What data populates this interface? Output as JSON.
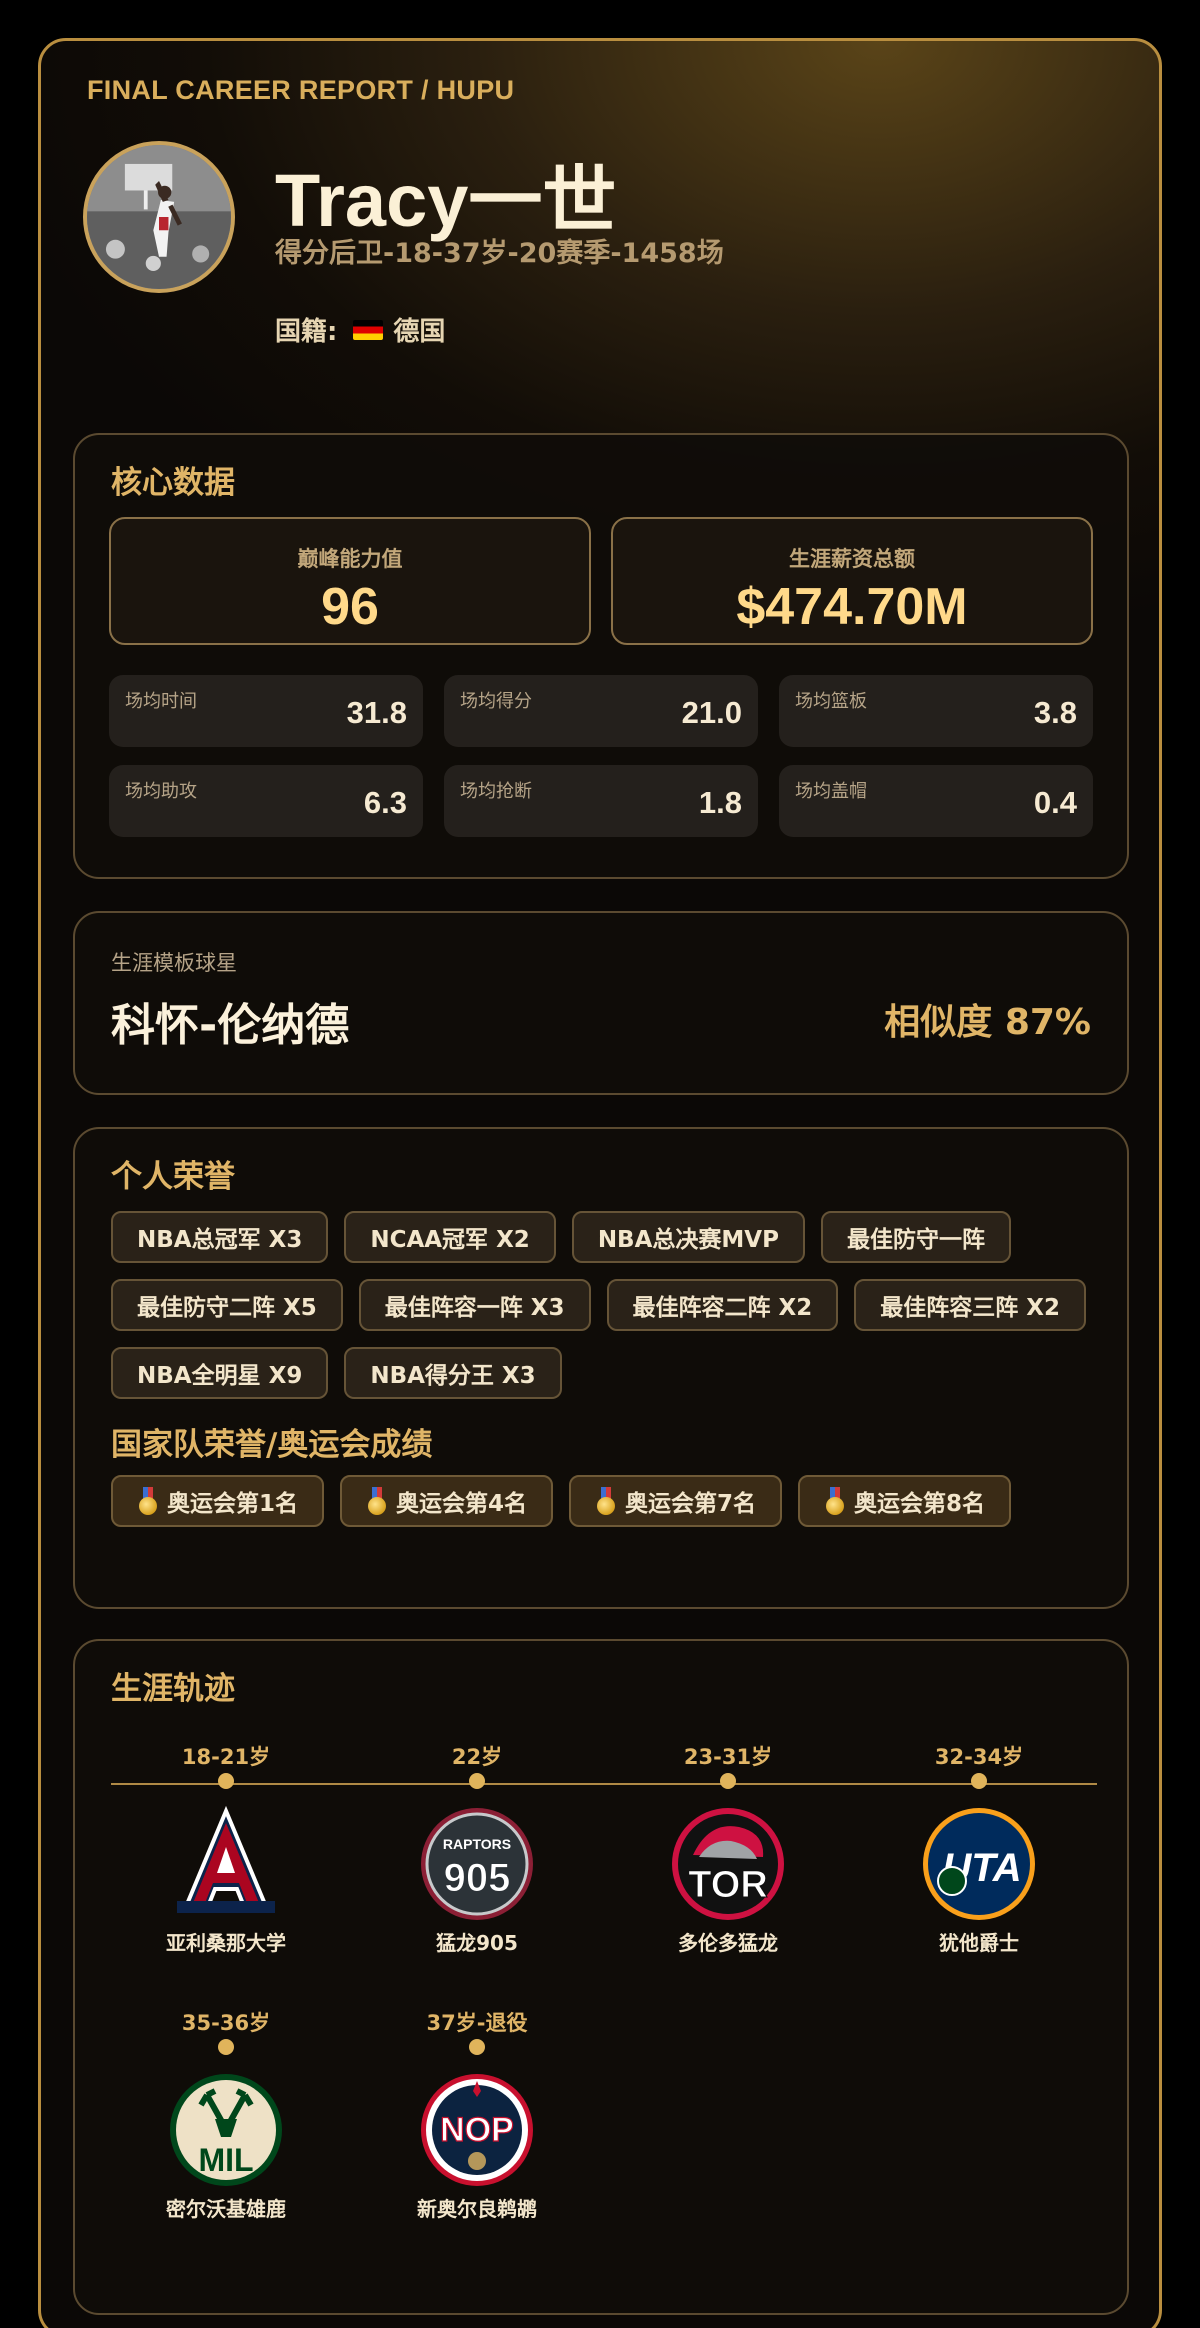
{
  "report_tag": "FINAL CAREER REPORT / HUPU",
  "player": {
    "name": "Tracy一世",
    "subtitle": "得分后卫-18-37岁-20赛季-1458场",
    "nationality_label": "国籍:",
    "nationality": "德国",
    "flag_icon": "germany-flag"
  },
  "core": {
    "title": "核心数据",
    "peak_label": "巅峰能力值",
    "peak_value": "96",
    "salary_label": "生涯薪资总额",
    "salary_value": "$474.70M",
    "stats": [
      {
        "label": "场均时间",
        "value": "31.8"
      },
      {
        "label": "场均得分",
        "value": "21.0"
      },
      {
        "label": "场均篮板",
        "value": "3.8"
      },
      {
        "label": "场均助攻",
        "value": "6.3"
      },
      {
        "label": "场均抢断",
        "value": "1.8"
      },
      {
        "label": "场均盖帽",
        "value": "0.4"
      }
    ]
  },
  "template": {
    "label": "生涯模板球星",
    "name": "科怀-伦纳德",
    "similarity": "相似度 87%"
  },
  "honors": {
    "title": "个人荣誉",
    "items": [
      "NBA总冠军 X3",
      "NCAA冠军 X2",
      "NBA总决赛MVP",
      "最佳防守一阵",
      "最佳防守二阵 X5",
      "最佳阵容一阵 X3",
      "最佳阵容二阵 X2",
      "最佳阵容三阵 X2",
      "NBA全明星 X9",
      "NBA得分王 X3"
    ],
    "national_title": "国家队荣誉/奥运会成绩",
    "olympics": [
      "奥运会第1名",
      "奥运会第4名",
      "奥运会第7名",
      "奥运会第8名"
    ]
  },
  "career": {
    "title": "生涯轨迹",
    "stops": [
      {
        "age": "18-21岁",
        "team": "亚利桑那大学",
        "logo": "arizona-wildcats-logo"
      },
      {
        "age": "22岁",
        "team": "猛龙905",
        "logo": "raptors-905-logo"
      },
      {
        "age": "23-31岁",
        "team": "多伦多猛龙",
        "logo": "toronto-raptors-logo"
      },
      {
        "age": "32-34岁",
        "team": "犹他爵士",
        "logo": "utah-jazz-logo"
      },
      {
        "age": "35-36岁",
        "team": "密尔沃基雄鹿",
        "logo": "milwaukee-bucks-logo"
      },
      {
        "age": "37岁-退役",
        "team": "新奥尔良鹈鹕",
        "logo": "new-orleans-pelicans-logo"
      }
    ],
    "logo_texts": {
      "raptors905_top": "RAPTORS",
      "raptors905_num": "905",
      "tor": "TOR",
      "uta": "UTA",
      "mil": "MIL",
      "nop": "NOP"
    }
  },
  "colors": {
    "accent_gold": "#e0b567",
    "border_gold": "#b98e3f",
    "background": "#000000"
  }
}
